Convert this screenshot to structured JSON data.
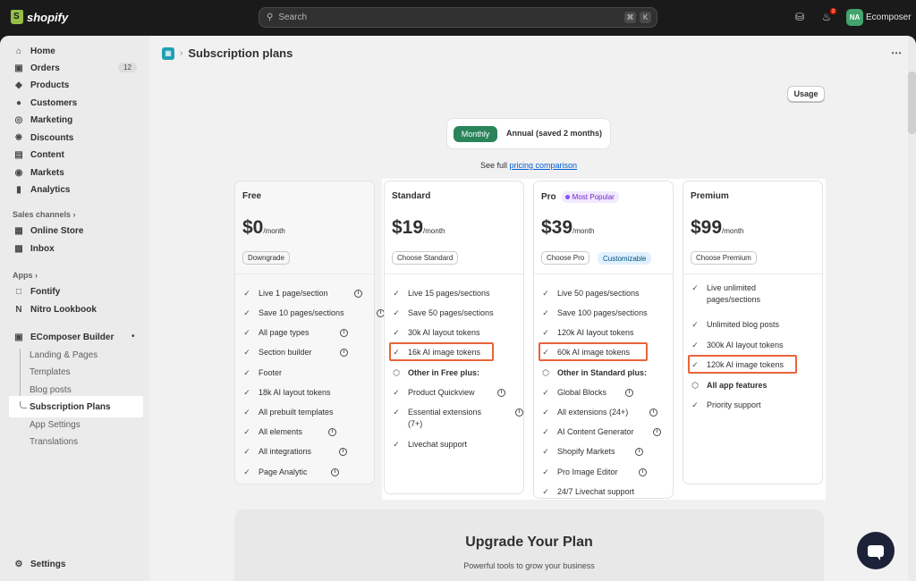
{
  "topbar": {
    "logo_text": "shopify",
    "search_placeholder": "Search",
    "search_key1": "⌘",
    "search_key2": "K",
    "notification_count": "2",
    "avatar_initials": "NA",
    "store_name": "Ecomposer"
  },
  "sidebar": {
    "items": [
      {
        "label": "Home",
        "icon": "home-icon"
      },
      {
        "label": "Orders",
        "icon": "orders-icon",
        "badge": "12"
      },
      {
        "label": "Products",
        "icon": "tag-icon"
      },
      {
        "label": "Customers",
        "icon": "person-icon"
      },
      {
        "label": "Marketing",
        "icon": "target-icon"
      },
      {
        "label": "Discounts",
        "icon": "discount-icon"
      },
      {
        "label": "Content",
        "icon": "content-icon"
      },
      {
        "label": "Markets",
        "icon": "globe-icon"
      },
      {
        "label": "Analytics",
        "icon": "bar-chart-icon"
      }
    ],
    "sales_channels_label": "Sales channels",
    "channels": [
      {
        "label": "Online Store",
        "icon": "store-icon"
      },
      {
        "label": "Inbox",
        "icon": "inbox-icon"
      }
    ],
    "apps_label": "Apps",
    "apps": [
      {
        "label": "Fontify",
        "icon": "fontify-icon"
      },
      {
        "label": "Nitro Lookbook",
        "icon": "nitro-icon"
      },
      {
        "label": "EComposer Builder",
        "icon": "ecomposer-icon"
      }
    ],
    "ecomposer_sub": [
      "Landing & Pages",
      "Templates",
      "Blog posts",
      "Subscription Plans",
      "App Settings",
      "Translations"
    ],
    "settings_label": "Settings"
  },
  "page": {
    "title": "Subscription plans",
    "usage_label": "Usage",
    "toggle_monthly": "Monthly",
    "toggle_annual": "Annual (saved 2 months)",
    "compare_prefix": "See full",
    "compare_link": "pricing comparison"
  },
  "plans": [
    {
      "name": "Free",
      "price": "$0",
      "per": "/month",
      "button": "Downgrade",
      "features": [
        {
          "text": "Live 1 page/section",
          "info": true
        },
        {
          "text": "Save 10 pages/sections",
          "info": true
        },
        {
          "text": "All page types",
          "info": true
        },
        {
          "text": "Section builder",
          "info": true
        },
        {
          "text": "Footer",
          "info": false
        },
        {
          "text": "18k AI layout tokens",
          "info": false
        },
        {
          "text": "All prebuilt templates",
          "info": false
        },
        {
          "text": "All elements",
          "info": true
        },
        {
          "text": "All integrations",
          "info": true
        },
        {
          "text": "Page Analytic",
          "info": true
        }
      ]
    },
    {
      "name": "Standard",
      "price": "$19",
      "per": "/month",
      "button": "Choose Standard",
      "features": [
        {
          "text": "Live 15 pages/sections",
          "info": false
        },
        {
          "text": "Save 50 pages/sections",
          "info": false
        },
        {
          "text": "30k AI layout tokens",
          "info": false
        },
        {
          "text": "16k AI image tokens",
          "info": false
        },
        {
          "text": "Other in Free plus:",
          "info": false,
          "bold": true,
          "icon": "cube-icon"
        },
        {
          "text": "Product Quickview",
          "info": true
        },
        {
          "text": "Essential extensions (7+)",
          "info": true
        },
        {
          "text": "Livechat support",
          "info": false
        }
      ]
    },
    {
      "name": "Pro",
      "badge": "Most Popular",
      "price": "$39",
      "per": "/month",
      "button": "Choose Pro",
      "extra_badge": "Customizable",
      "features": [
        {
          "text": "Live 50 pages/sections",
          "info": false
        },
        {
          "text": "Save 100 pages/sections",
          "info": false
        },
        {
          "text": "120k AI layout tokens",
          "info": false
        },
        {
          "text": "60k AI image tokens",
          "info": false
        },
        {
          "text": "Other in Standard plus:",
          "info": false,
          "bold": true,
          "icon": "cube-icon"
        },
        {
          "text": "Global Blocks",
          "info": true
        },
        {
          "text": "All extensions (24+)",
          "info": true
        },
        {
          "text": "AI Content Generator",
          "info": true
        },
        {
          "text": "Shopify Markets",
          "info": true
        },
        {
          "text": "Pro Image Editor",
          "info": true
        },
        {
          "text": "24/7 Livechat support",
          "info": false
        }
      ]
    },
    {
      "name": "Premium",
      "price": "$99",
      "per": "/month",
      "button": "Choose Premium",
      "features": [
        {
          "text": "Live unlimited pages/sections",
          "info": false
        },
        {
          "text": "Unlimited blog posts",
          "info": false
        },
        {
          "text": "300k AI layout tokens",
          "info": false
        },
        {
          "text": "120k AI image tokens",
          "info": false
        },
        {
          "text": "All app features",
          "info": false,
          "bold": true,
          "icon": "cube-icon"
        },
        {
          "text": "Priority support",
          "info": false
        }
      ]
    }
  ],
  "upgrade": {
    "title": "Upgrade Your Plan",
    "subtitle": "Powerful tools to grow your business"
  },
  "colors": {
    "primary_green": "#29845a",
    "highlight_orange": "#e8643a",
    "popular_purple": "#7126c9",
    "link_blue": "#005bd3"
  }
}
